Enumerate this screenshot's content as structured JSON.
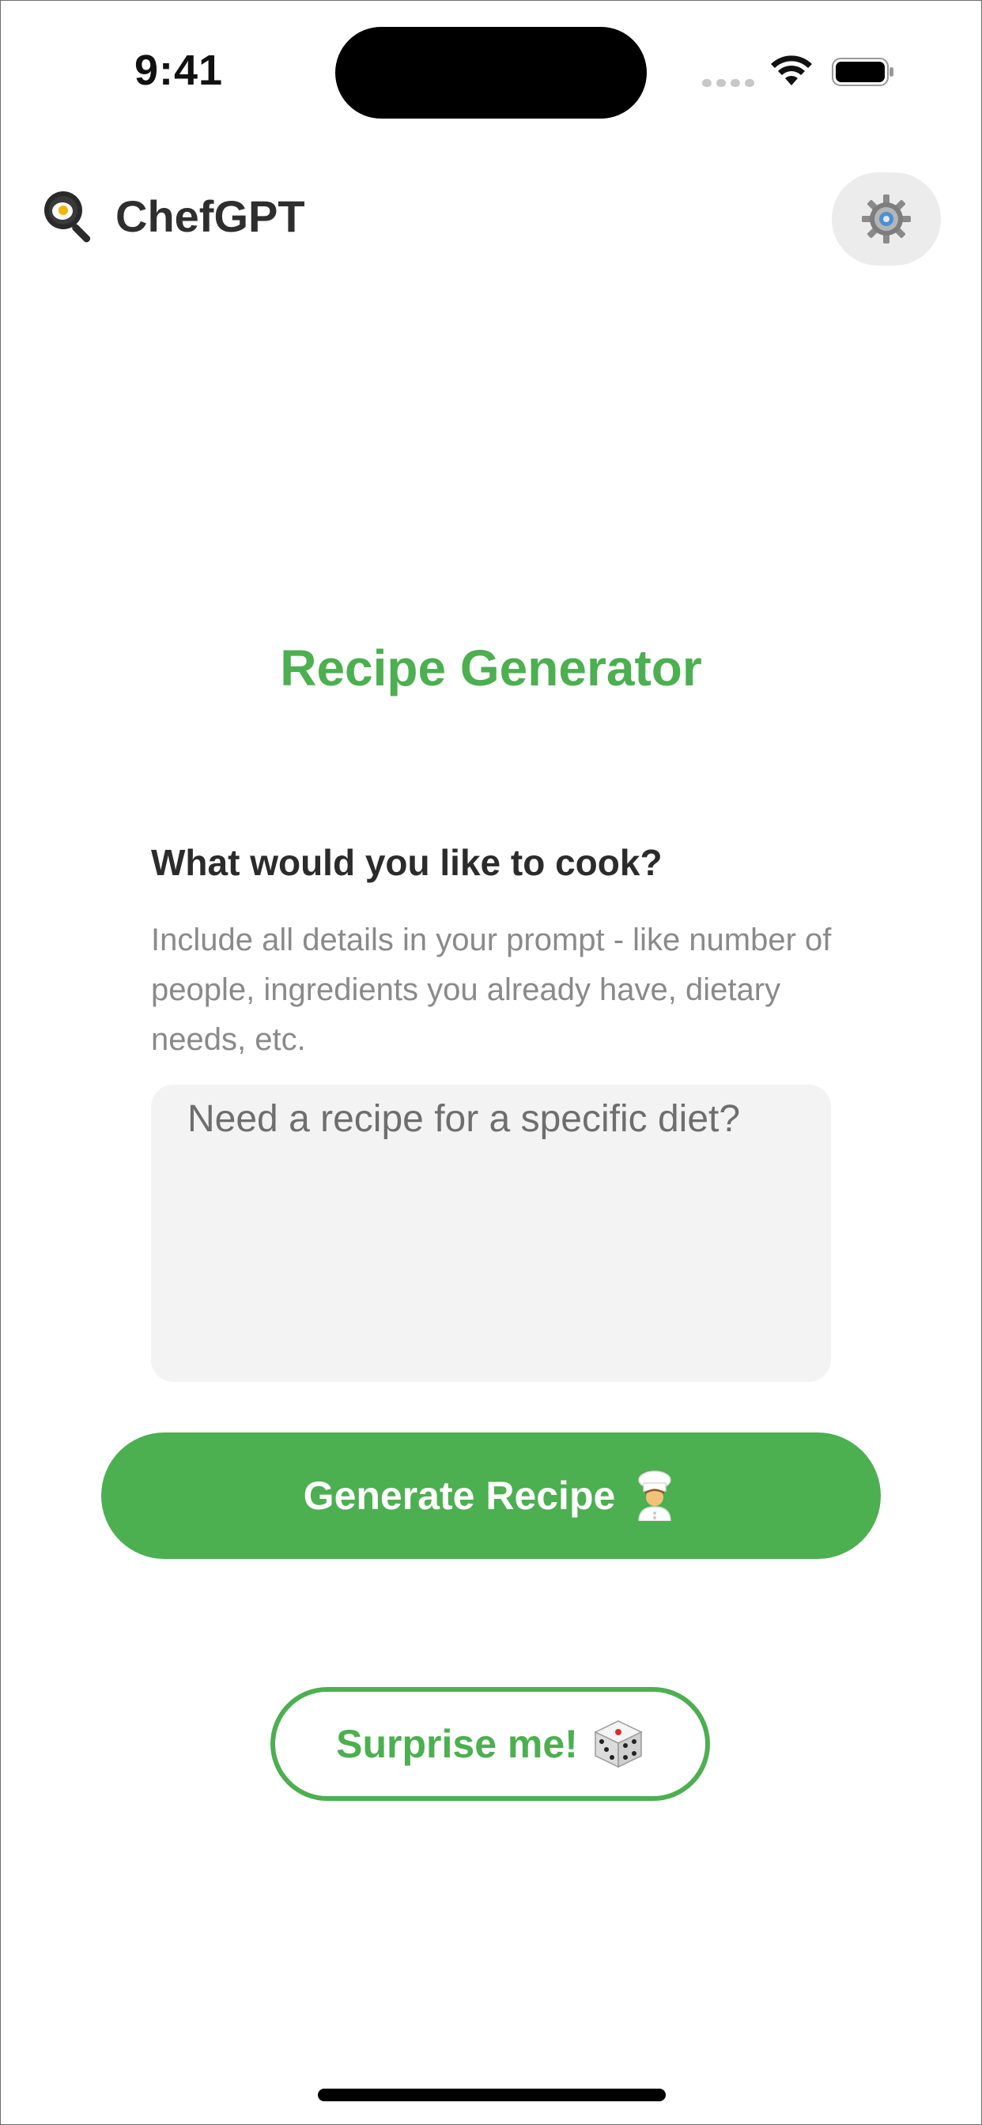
{
  "status_bar": {
    "time": "9:41"
  },
  "header": {
    "app_name": "ChefGPT",
    "logo_icon": "frying-pan-icon",
    "settings_icon": "gear-icon"
  },
  "main": {
    "title": "Recipe Generator",
    "question": "What would you like to cook?",
    "hint": "Include all details in your prompt - like number of people, ingredients you already have, dietary needs, etc.",
    "prompt": {
      "placeholder": "Need a recipe for a specific diet?",
      "value": ""
    },
    "generate_button": {
      "label": "Generate Recipe",
      "icon": "chef-icon"
    },
    "surprise_button": {
      "label": "Surprise me!",
      "icon": "dice-icon"
    }
  },
  "colors": {
    "accent": "#4caf50",
    "background": "#ffffff",
    "input_bg": "#f3f3f3"
  }
}
